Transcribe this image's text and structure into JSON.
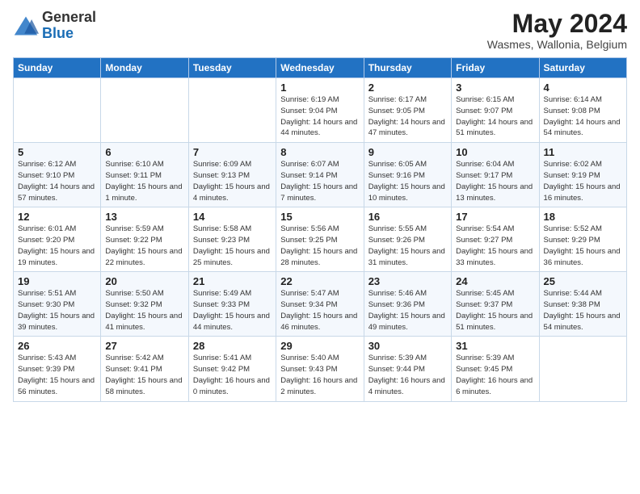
{
  "header": {
    "logo_general": "General",
    "logo_blue": "Blue",
    "month_title": "May 2024",
    "subtitle": "Wasmes, Wallonia, Belgium"
  },
  "weekdays": [
    "Sunday",
    "Monday",
    "Tuesday",
    "Wednesday",
    "Thursday",
    "Friday",
    "Saturday"
  ],
  "weeks": [
    [
      {
        "day": "",
        "sunrise": "",
        "sunset": "",
        "daylight": ""
      },
      {
        "day": "",
        "sunrise": "",
        "sunset": "",
        "daylight": ""
      },
      {
        "day": "",
        "sunrise": "",
        "sunset": "",
        "daylight": ""
      },
      {
        "day": "1",
        "sunrise": "Sunrise: 6:19 AM",
        "sunset": "Sunset: 9:04 PM",
        "daylight": "Daylight: 14 hours and 44 minutes."
      },
      {
        "day": "2",
        "sunrise": "Sunrise: 6:17 AM",
        "sunset": "Sunset: 9:05 PM",
        "daylight": "Daylight: 14 hours and 47 minutes."
      },
      {
        "day": "3",
        "sunrise": "Sunrise: 6:15 AM",
        "sunset": "Sunset: 9:07 PM",
        "daylight": "Daylight: 14 hours and 51 minutes."
      },
      {
        "day": "4",
        "sunrise": "Sunrise: 6:14 AM",
        "sunset": "Sunset: 9:08 PM",
        "daylight": "Daylight: 14 hours and 54 minutes."
      }
    ],
    [
      {
        "day": "5",
        "sunrise": "Sunrise: 6:12 AM",
        "sunset": "Sunset: 9:10 PM",
        "daylight": "Daylight: 14 hours and 57 minutes."
      },
      {
        "day": "6",
        "sunrise": "Sunrise: 6:10 AM",
        "sunset": "Sunset: 9:11 PM",
        "daylight": "Daylight: 15 hours and 1 minute."
      },
      {
        "day": "7",
        "sunrise": "Sunrise: 6:09 AM",
        "sunset": "Sunset: 9:13 PM",
        "daylight": "Daylight: 15 hours and 4 minutes."
      },
      {
        "day": "8",
        "sunrise": "Sunrise: 6:07 AM",
        "sunset": "Sunset: 9:14 PM",
        "daylight": "Daylight: 15 hours and 7 minutes."
      },
      {
        "day": "9",
        "sunrise": "Sunrise: 6:05 AM",
        "sunset": "Sunset: 9:16 PM",
        "daylight": "Daylight: 15 hours and 10 minutes."
      },
      {
        "day": "10",
        "sunrise": "Sunrise: 6:04 AM",
        "sunset": "Sunset: 9:17 PM",
        "daylight": "Daylight: 15 hours and 13 minutes."
      },
      {
        "day": "11",
        "sunrise": "Sunrise: 6:02 AM",
        "sunset": "Sunset: 9:19 PM",
        "daylight": "Daylight: 15 hours and 16 minutes."
      }
    ],
    [
      {
        "day": "12",
        "sunrise": "Sunrise: 6:01 AM",
        "sunset": "Sunset: 9:20 PM",
        "daylight": "Daylight: 15 hours and 19 minutes."
      },
      {
        "day": "13",
        "sunrise": "Sunrise: 5:59 AM",
        "sunset": "Sunset: 9:22 PM",
        "daylight": "Daylight: 15 hours and 22 minutes."
      },
      {
        "day": "14",
        "sunrise": "Sunrise: 5:58 AM",
        "sunset": "Sunset: 9:23 PM",
        "daylight": "Daylight: 15 hours and 25 minutes."
      },
      {
        "day": "15",
        "sunrise": "Sunrise: 5:56 AM",
        "sunset": "Sunset: 9:25 PM",
        "daylight": "Daylight: 15 hours and 28 minutes."
      },
      {
        "day": "16",
        "sunrise": "Sunrise: 5:55 AM",
        "sunset": "Sunset: 9:26 PM",
        "daylight": "Daylight: 15 hours and 31 minutes."
      },
      {
        "day": "17",
        "sunrise": "Sunrise: 5:54 AM",
        "sunset": "Sunset: 9:27 PM",
        "daylight": "Daylight: 15 hours and 33 minutes."
      },
      {
        "day": "18",
        "sunrise": "Sunrise: 5:52 AM",
        "sunset": "Sunset: 9:29 PM",
        "daylight": "Daylight: 15 hours and 36 minutes."
      }
    ],
    [
      {
        "day": "19",
        "sunrise": "Sunrise: 5:51 AM",
        "sunset": "Sunset: 9:30 PM",
        "daylight": "Daylight: 15 hours and 39 minutes."
      },
      {
        "day": "20",
        "sunrise": "Sunrise: 5:50 AM",
        "sunset": "Sunset: 9:32 PM",
        "daylight": "Daylight: 15 hours and 41 minutes."
      },
      {
        "day": "21",
        "sunrise": "Sunrise: 5:49 AM",
        "sunset": "Sunset: 9:33 PM",
        "daylight": "Daylight: 15 hours and 44 minutes."
      },
      {
        "day": "22",
        "sunrise": "Sunrise: 5:47 AM",
        "sunset": "Sunset: 9:34 PM",
        "daylight": "Daylight: 15 hours and 46 minutes."
      },
      {
        "day": "23",
        "sunrise": "Sunrise: 5:46 AM",
        "sunset": "Sunset: 9:36 PM",
        "daylight": "Daylight: 15 hours and 49 minutes."
      },
      {
        "day": "24",
        "sunrise": "Sunrise: 5:45 AM",
        "sunset": "Sunset: 9:37 PM",
        "daylight": "Daylight: 15 hours and 51 minutes."
      },
      {
        "day": "25",
        "sunrise": "Sunrise: 5:44 AM",
        "sunset": "Sunset: 9:38 PM",
        "daylight": "Daylight: 15 hours and 54 minutes."
      }
    ],
    [
      {
        "day": "26",
        "sunrise": "Sunrise: 5:43 AM",
        "sunset": "Sunset: 9:39 PM",
        "daylight": "Daylight: 15 hours and 56 minutes."
      },
      {
        "day": "27",
        "sunrise": "Sunrise: 5:42 AM",
        "sunset": "Sunset: 9:41 PM",
        "daylight": "Daylight: 15 hours and 58 minutes."
      },
      {
        "day": "28",
        "sunrise": "Sunrise: 5:41 AM",
        "sunset": "Sunset: 9:42 PM",
        "daylight": "Daylight: 16 hours and 0 minutes."
      },
      {
        "day": "29",
        "sunrise": "Sunrise: 5:40 AM",
        "sunset": "Sunset: 9:43 PM",
        "daylight": "Daylight: 16 hours and 2 minutes."
      },
      {
        "day": "30",
        "sunrise": "Sunrise: 5:39 AM",
        "sunset": "Sunset: 9:44 PM",
        "daylight": "Daylight: 16 hours and 4 minutes."
      },
      {
        "day": "31",
        "sunrise": "Sunrise: 5:39 AM",
        "sunset": "Sunset: 9:45 PM",
        "daylight": "Daylight: 16 hours and 6 minutes."
      },
      {
        "day": "",
        "sunrise": "",
        "sunset": "",
        "daylight": ""
      }
    ]
  ]
}
